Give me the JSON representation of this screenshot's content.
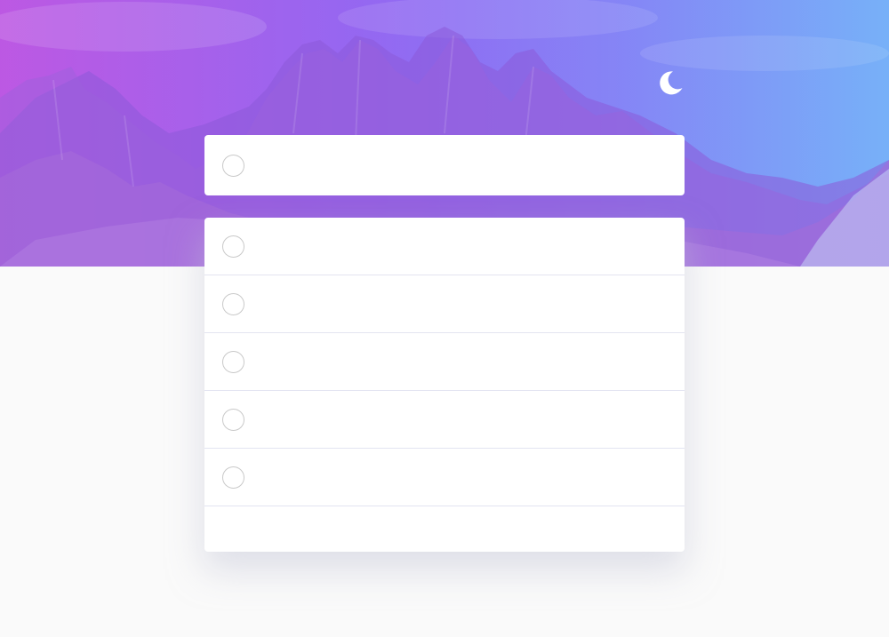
{
  "header": {
    "theme_toggle_icon": "moon-icon"
  },
  "new_todo": {
    "value": "",
    "placeholder": ""
  },
  "todos": [
    {
      "text": "",
      "completed": false
    },
    {
      "text": "",
      "completed": false
    },
    {
      "text": "",
      "completed": false
    },
    {
      "text": "",
      "completed": false
    },
    {
      "text": "",
      "completed": false
    }
  ],
  "footer": {
    "items_left": ""
  },
  "colors": {
    "gradient_start": "#b24fe0",
    "gradient_end": "#6aa8f7",
    "page_background": "#fafafa",
    "card_background": "#ffffff",
    "circle_border": "#c9c9c9"
  }
}
